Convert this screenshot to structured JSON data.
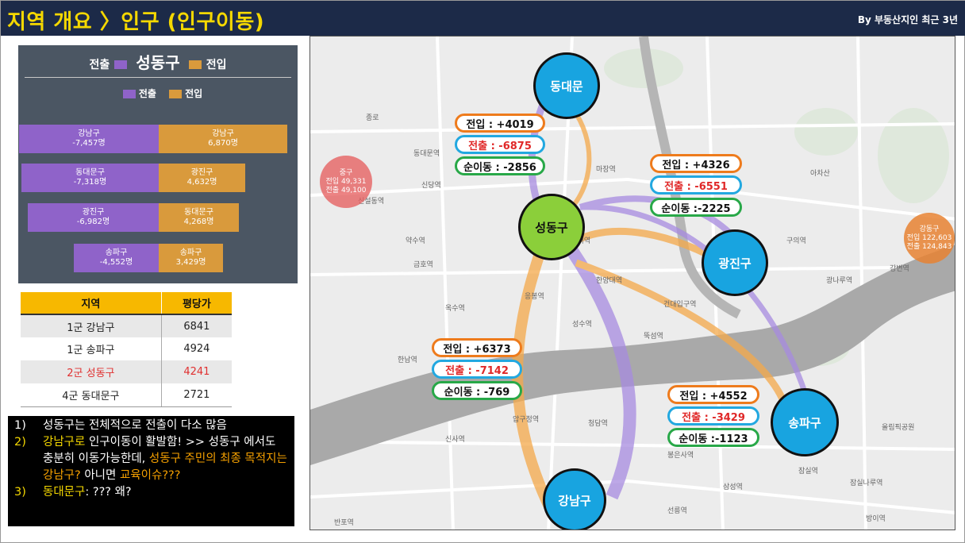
{
  "header": {
    "title": "지역 개요 〉인구 (인구이동)",
    "subtitle": "By 부동산지인 최근 3년"
  },
  "chart": {
    "title_left": "전출",
    "title_center": "성동구",
    "title_right": "전입",
    "legend_out": "전출",
    "legend_in": "전입",
    "colors": {
      "out": "#8f63c9",
      "in": "#d99a3c"
    }
  },
  "chart_data": {
    "type": "bar",
    "title": "전출 성동구 전입",
    "series": [
      {
        "name": "전출",
        "categories": [
          "강남구",
          "동대문구",
          "광진구",
          "송파구"
        ],
        "values": [
          -7457,
          -7318,
          -6982,
          -4552
        ]
      },
      {
        "name": "전입",
        "categories": [
          "강남구",
          "광진구",
          "동대문구",
          "송파구"
        ],
        "values": [
          6870,
          4632,
          4268,
          3429
        ]
      }
    ],
    "labels": {
      "out": [
        "-7,457명",
        "-7,318명",
        "-6,982명",
        "-4,552명"
      ],
      "in": [
        "6,870명",
        "4,632명",
        "4,268명",
        "3,429명"
      ]
    }
  },
  "price_table": {
    "headers": [
      "지역",
      "평당가"
    ],
    "rows": [
      {
        "region": "1군 강남구",
        "price": "6841"
      },
      {
        "region": "1군 송파구",
        "price": "4924"
      },
      {
        "region": "2군 성동구",
        "price": "4241"
      },
      {
        "region": "4군 동대문구",
        "price": "2721"
      }
    ]
  },
  "notes": {
    "n1": "1)",
    "t1": "성동구는 전체적으로 전출이 다소 많음",
    "n2": "2)",
    "t2a": "강남구로",
    "t2b": " 인구이동이 활발함! >> 성동구 에서도 충분히 이동가능한데, ",
    "t2c": "성동구 주민의 최종 목적지는 강남구?",
    "t2d": " 아니면 ",
    "t2e": "교육이슈???",
    "n3": "3)",
    "t3a": "동대문구",
    "t3b": ": ??? 왜?"
  },
  "map": {
    "nodes": {
      "dongdaemun": "동대문",
      "seongdong": "성동구",
      "gwangjin": "광진구",
      "gangnam": "강남구",
      "songpa": "송파구"
    },
    "pills": {
      "ddm_in": "전입 : +4019",
      "ddm_out": "전출 : -6875",
      "ddm_net": "순이동 : -2856",
      "gj_in": "전입 : +4326",
      "gj_out": "전출 : -6551",
      "gj_net": "순이동 :-2225",
      "gn_in": "전입 : +6373",
      "gn_out": "전출 : -7142",
      "gn_net": "순이동 : -769",
      "sp_in": "전입 : +4552",
      "sp_out": "전출 : -3429",
      "sp_net": "순이동 :-1123"
    },
    "gu_circles": {
      "junggu_name": "중구",
      "junggu_l1": "전입 49,331",
      "junggu_l2": "전출 49,100",
      "gangdong_name": "강동구",
      "gangdong_l1": "전입 122,603",
      "gangdong_l2": "전출 124,843"
    },
    "labels": [
      "종로",
      "동대문역",
      "신설동역",
      "왕십리역",
      "한양대역",
      "뚝섬역",
      "건대입구역",
      "아차산",
      "광나루역",
      "잠실역",
      "삼성역",
      "선릉역",
      "신사역",
      "압구정역",
      "청담역",
      "봉은사역",
      "잠실나루역",
      "올림픽공원",
      "방이역",
      "반포역",
      "옥수역",
      "한남역",
      "금호역",
      "약수역",
      "신당역",
      "응봉역",
      "성수역",
      "구의역",
      "강변역",
      "마장역"
    ]
  }
}
